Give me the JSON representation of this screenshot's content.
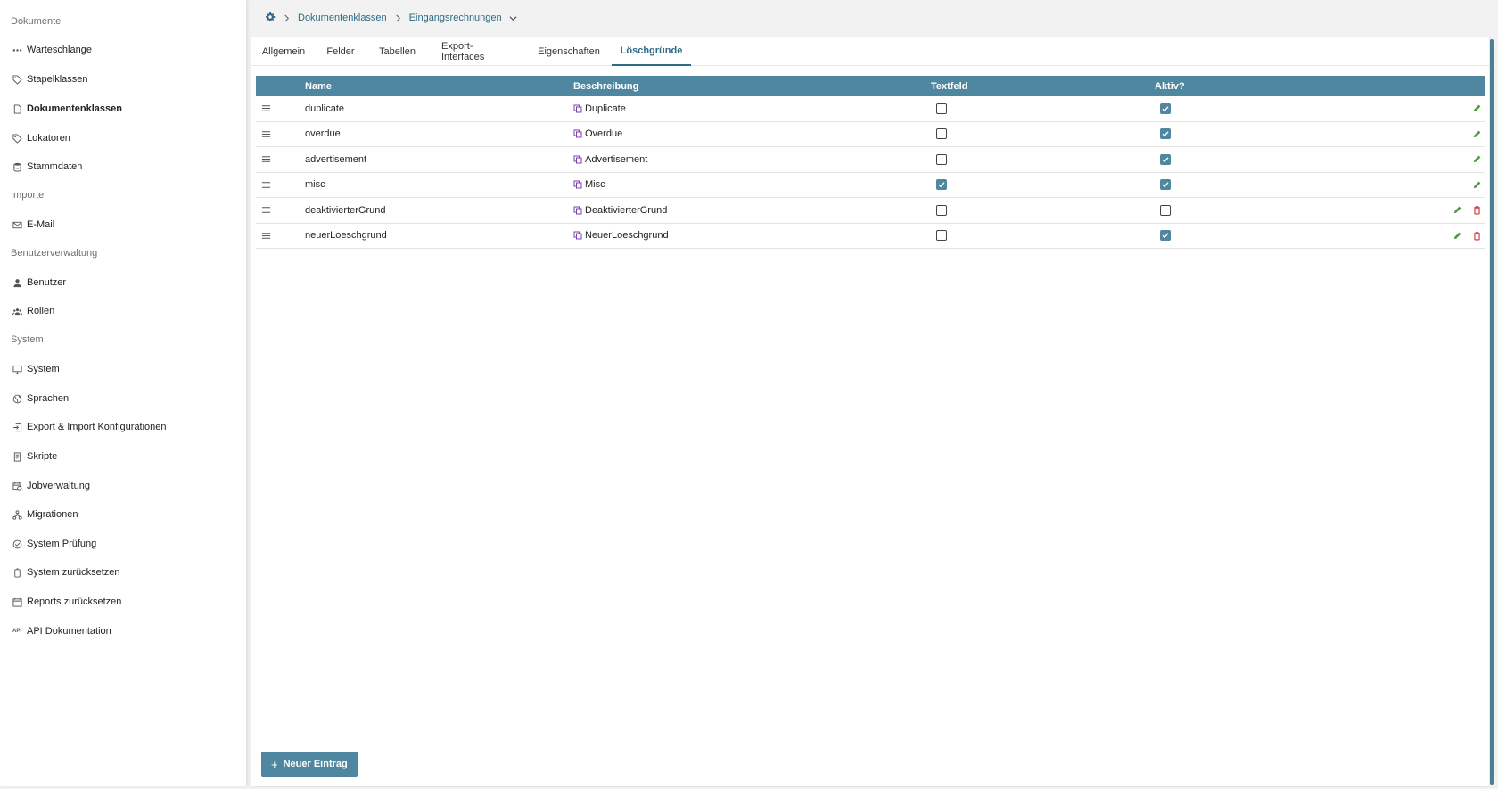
{
  "sidebar": {
    "sections": [
      {
        "label": "Dokumente"
      },
      {
        "label": "Importe"
      },
      {
        "label": "Benutzerverwaltung"
      },
      {
        "label": "System"
      }
    ],
    "items": [
      {
        "label": "Warteschlange",
        "icon": "queue-icon"
      },
      {
        "label": "Stapelklassen",
        "icon": "tag-icon"
      },
      {
        "label": "Dokumentenklassen",
        "icon": "document-icon",
        "active": true
      },
      {
        "label": "Lokatoren",
        "icon": "tag-icon"
      },
      {
        "label": "Stammdaten",
        "icon": "database-icon"
      },
      {
        "label": "E-Mail",
        "icon": "mail-icon"
      },
      {
        "label": "Benutzer",
        "icon": "user-icon"
      },
      {
        "label": "Rollen",
        "icon": "group-icon"
      },
      {
        "label": "System",
        "icon": "monitor-icon"
      },
      {
        "label": "Sprachen",
        "icon": "globe-icon"
      },
      {
        "label": "Export & Import Konfigurationen",
        "icon": "import-icon"
      },
      {
        "label": "Skripte",
        "icon": "script-icon"
      },
      {
        "label": "Jobverwaltung",
        "icon": "calendar-clock-icon"
      },
      {
        "label": "Migrationen",
        "icon": "migration-icon"
      },
      {
        "label": "System Prüfung",
        "icon": "check-circle-icon"
      },
      {
        "label": "System zurücksetzen",
        "icon": "reset-icon"
      },
      {
        "label": "Reports zurücksetzen",
        "icon": "calendar-reset-icon"
      },
      {
        "label": "API Dokumentation",
        "icon": "api-icon"
      }
    ]
  },
  "breadcrumb": {
    "items": [
      "Dokumentenklassen",
      "Eingangsrechnungen"
    ]
  },
  "tabs": [
    {
      "label": "Allgemein"
    },
    {
      "label": "Felder"
    },
    {
      "label": "Tabellen"
    },
    {
      "label": "Export-Interfaces"
    },
    {
      "label": "Eigenschaften"
    },
    {
      "label": "Löschgründe",
      "active": true
    }
  ],
  "table": {
    "columns": [
      "Name",
      "Beschreibung",
      "Textfeld",
      "Aktiv?"
    ],
    "rows": [
      {
        "name": "duplicate",
        "description": "Duplicate",
        "textfeld": false,
        "aktiv": true,
        "deletable": false
      },
      {
        "name": "overdue",
        "description": "Overdue",
        "textfeld": false,
        "aktiv": true,
        "deletable": false
      },
      {
        "name": "advertisement",
        "description": "Advertisement",
        "textfeld": false,
        "aktiv": true,
        "deletable": false
      },
      {
        "name": "misc",
        "description": "Misc",
        "textfeld": true,
        "aktiv": true,
        "deletable": false
      },
      {
        "name": "deaktivierterGrund",
        "description": "DeaktivierterGrund",
        "textfeld": false,
        "aktiv": false,
        "deletable": true
      },
      {
        "name": "neuerLoeschgrund",
        "description": "NeuerLoeschgrund",
        "textfeld": false,
        "aktiv": true,
        "deletable": true
      }
    ]
  },
  "new_button": {
    "label": "Neuer Eintrag"
  },
  "colors": {
    "accent": "#4f87a0",
    "link": "#2f6b86",
    "edit": "#4a9a3c",
    "delete": "#d0302f"
  }
}
